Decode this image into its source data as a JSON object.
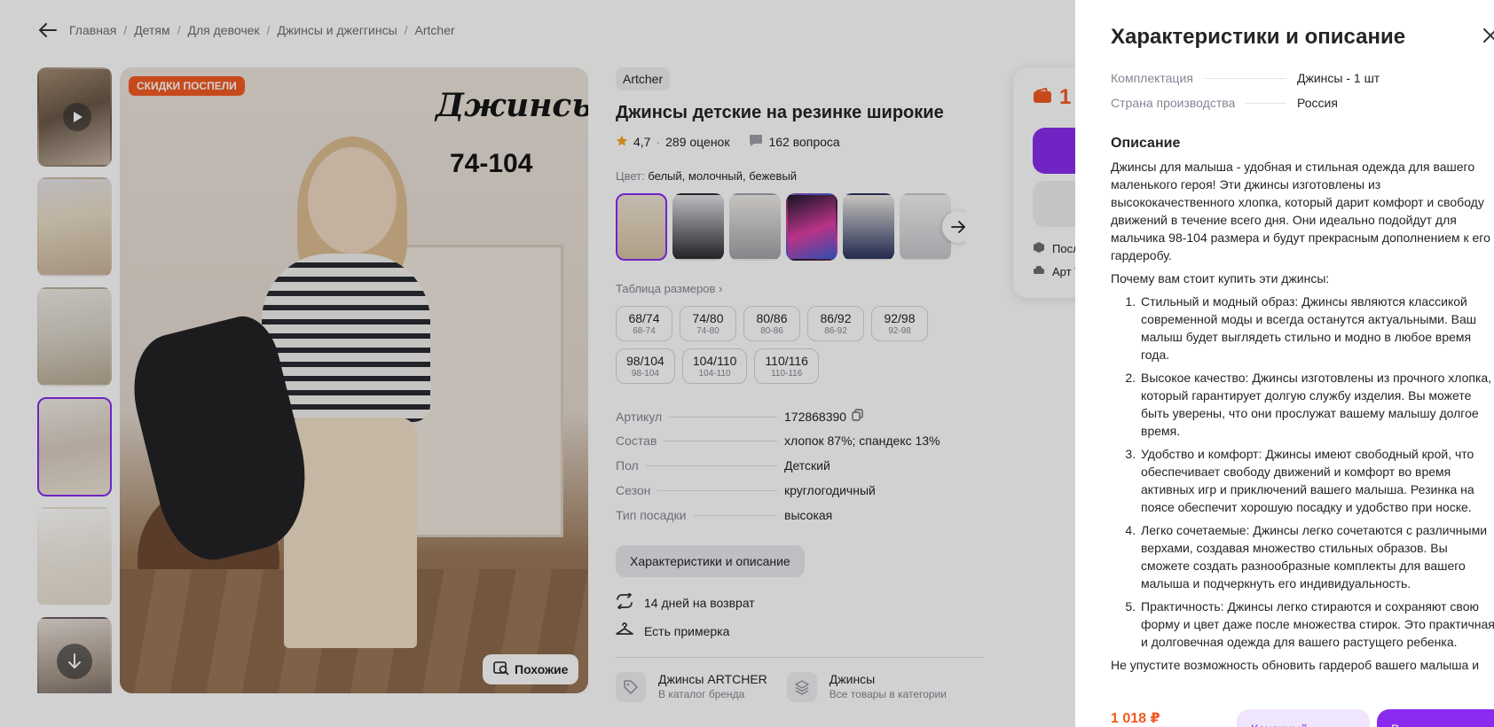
{
  "breadcrumb": {
    "items": [
      "Главная",
      "Детям",
      "Для девочек",
      "Джинсы и джеггинсы",
      "Artcher"
    ],
    "separator": "/"
  },
  "gallery": {
    "sale_badge": "СКИДКИ ПОСПЕЛИ",
    "photo_title": "Джинсы",
    "photo_size": "74-104",
    "similar_button": "Похожие"
  },
  "product": {
    "brand": "Artcher",
    "title": "Джинсы детские на резинке широкие",
    "rating": "4,7",
    "reviews": "289 оценок",
    "questions": "162 вопроса",
    "color_label": "Цвет:",
    "color_value": "белый, молочный, бежевый",
    "size_table_link": "Таблица размеров",
    "sizes": [
      {
        "main": "68/74",
        "sub": "68-74"
      },
      {
        "main": "74/80",
        "sub": "74-80"
      },
      {
        "main": "80/86",
        "sub": "80-86"
      },
      {
        "main": "86/92",
        "sub": "86-92"
      },
      {
        "main": "92/98",
        "sub": "92-98"
      },
      {
        "main": "98/104",
        "sub": "98-104"
      },
      {
        "main": "104/110",
        "sub": "104-110"
      },
      {
        "main": "110/116",
        "sub": "110-116"
      }
    ],
    "specs": [
      {
        "k": "Артикул",
        "v": "172868390"
      },
      {
        "k": "Состав",
        "v": "хлопок 87%; спандекс 13%"
      },
      {
        "k": "Пол",
        "v": "Детский"
      },
      {
        "k": "Сезон",
        "v": "круглогодичный"
      },
      {
        "k": "Тип посадки",
        "v": "высокая"
      }
    ],
    "description_button": "Характеристики и описание",
    "perks": [
      "14 дней на возврат",
      "Есть примерка"
    ],
    "brand_card": {
      "name": "Джинсы ARTCHER",
      "sub": "В каталог бренда"
    },
    "category_card": {
      "name": "Джинсы",
      "sub": "Все товары в категории"
    }
  },
  "price_card": {
    "price_partial": "1",
    "line1": "Посл",
    "line2": "Арт V"
  },
  "panel": {
    "title": "Характеристики и описание",
    "specs": [
      {
        "k": "Комплектация",
        "v": "Джинсы - 1 шт"
      },
      {
        "k": "Страна производства",
        "v": "Россия"
      }
    ],
    "description_heading": "Описание",
    "intro": "Джинсы для малыша - удобная и стильная одежда для вашего маленького героя! Эти джинсы изготовлены из высококачественного хлопка, который дарит комфорт и свободу движений в течение всего дня. Они идеально подойдут для мальчика 98-104 размера и будут прекрасным дополнением к его гардеробу.",
    "why": "Почему вам стоит купить эти джинсы:",
    "reasons": [
      "Стильный и модный образ: Джинсы являются классикой современной моды и всегда останутся актуальными. Ваш малыш будет выглядеть стильно и модно в любое время года.",
      "Высокое качество: Джинсы изготовлены из прочного хлопка, который гарантирует долгую службу изделия. Вы можете быть уверены, что они прослужат вашему малышу долгое время.",
      "Удобство и комфорт: Джинсы имеют свободный крой, что обеспечивает свободу движений и комфорт во время активных игр и приключений вашего малыша. Резинка на поясе обеспечит хорошую посадку и удобство при носке.",
      "Легко сочетаемые: Джинсы легко сочетаются с различными верхами, создавая множество стильных образов. Вы сможете создать разнообразные комплекты для вашего малыша и подчеркнуть его индивидуальность.",
      "Практичность: Джинсы легко стираются и сохраняют свою форму и цвет даже после множества стирок. Это практичная и долговечная одежда для вашего растущего ребенка."
    ],
    "outro": "Не упустите возможность обновить гардероб вашего малыша и",
    "footer_price": "1 018 ₽",
    "footer_btn1": "Конечный",
    "footer_btn2": "В"
  },
  "colors": {
    "accent": "#8a2cf0",
    "sale": "#f25b23",
    "star": "#f5a623"
  }
}
